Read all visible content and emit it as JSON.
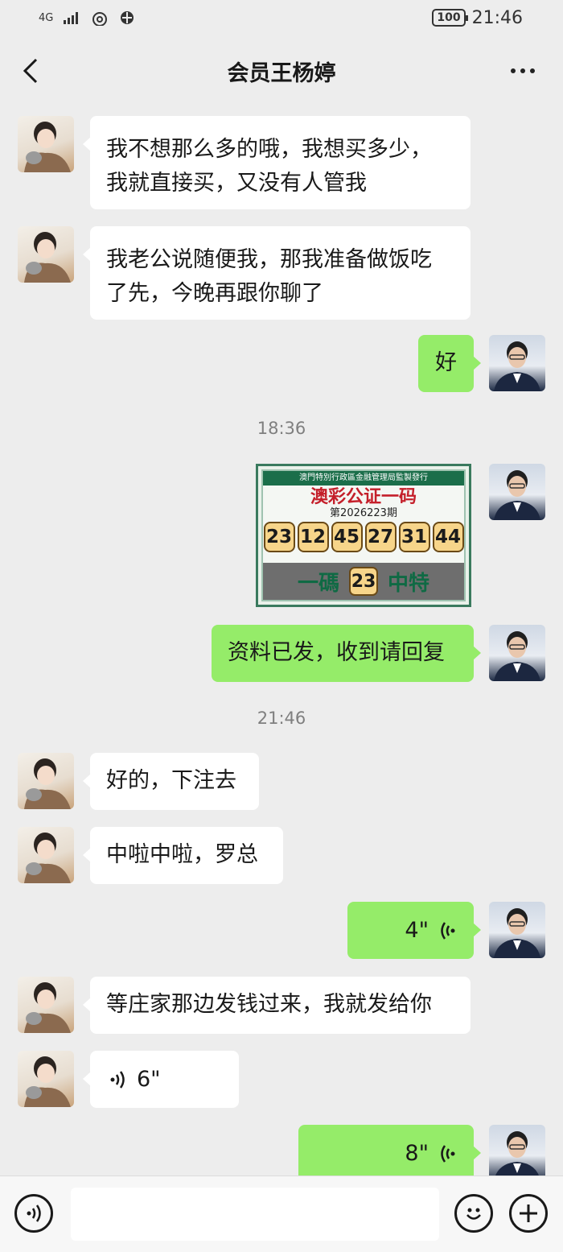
{
  "status_bar": {
    "network": "4G",
    "time": "21:46",
    "battery": "100"
  },
  "header": {
    "title": "会员王杨婷"
  },
  "messages": [
    {
      "text": "我不想那么多的哦，我想买多少，\n我就直接买，又没有人管我"
    },
    {
      "text": "我老公说随便我，那我准备做饭吃\n了先，今晚再跟你聊了"
    },
    {
      "text": "好"
    },
    {
      "text": "资料已发，收到请回复"
    },
    {
      "text": "好的，下注去"
    },
    {
      "text": "中啦中啦，罗总"
    },
    {
      "text": "等庄家那边发钱过来，我就发给你"
    }
  ],
  "voice_messages": [
    {
      "duration": "4\""
    },
    {
      "duration": "6\""
    },
    {
      "duration": "8\""
    }
  ],
  "timestamps": [
    "18:36",
    "21:46"
  ],
  "lottery_card": {
    "header": "澳門特別行政區金融管理局監製發行",
    "title": "澳彩公证一码",
    "period": "第2026223期",
    "numbers": [
      "23",
      "12",
      "45",
      "27",
      "31",
      "44"
    ],
    "bottom_left": "一碼",
    "special": "23",
    "bottom_right": "中特"
  },
  "input": {
    "placeholder": ""
  },
  "icons": {
    "back": "chevron-left-icon",
    "more": "more-dots-icon",
    "voice": "voice-wave-icon",
    "emoji": "emoji-icon",
    "plus": "plus-icon"
  },
  "colors": {
    "background": "#ededed",
    "my_bubble": "#95ec69",
    "their_bubble": "#ffffff"
  }
}
